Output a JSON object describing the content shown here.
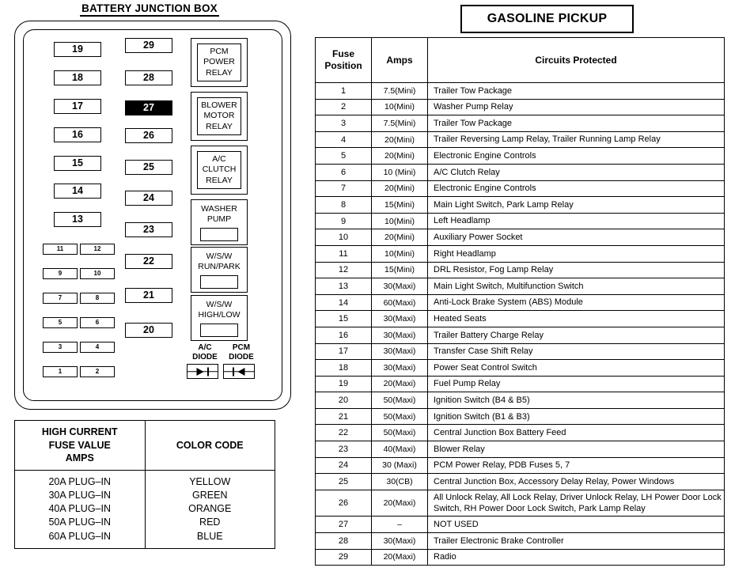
{
  "diagram": {
    "title": "BATTERY JUNCTION BOX",
    "big_fuses_left": [
      "19",
      "18",
      "17",
      "16",
      "15",
      "14",
      "13"
    ],
    "big_fuses_right": [
      "29",
      "28",
      "27",
      "26",
      "25",
      "24",
      "23",
      "22",
      "21",
      "20"
    ],
    "active_fuse": "27",
    "small_fuses": [
      [
        "11",
        "12"
      ],
      [
        "9",
        "10"
      ],
      [
        "7",
        "8"
      ],
      [
        "5",
        "6"
      ],
      [
        "3",
        "4"
      ],
      [
        "1",
        "2"
      ]
    ],
    "relays": [
      {
        "lines": [
          "PCM",
          "POWER",
          "RELAY"
        ],
        "style": "boxed"
      },
      {
        "lines": [
          "BLOWER",
          "MOTOR",
          "RELAY"
        ],
        "style": "boxed"
      },
      {
        "lines": [
          "A/C",
          "CLUTCH",
          "RELAY"
        ],
        "style": "boxed"
      },
      {
        "lines": [
          "WASHER",
          "PUMP"
        ],
        "style": "slot"
      },
      {
        "lines": [
          "W/S/W",
          "RUN/PARK"
        ],
        "style": "slot"
      },
      {
        "lines": [
          "W/S/W",
          "HIGH/LOW"
        ],
        "style": "slot"
      }
    ],
    "diodes": [
      {
        "line1": "A/C",
        "line2": "DIODE",
        "direction": "right"
      },
      {
        "line1": "PCM",
        "line2": "DIODE",
        "direction": "left"
      }
    ]
  },
  "legend": {
    "header_left": "HIGH CURRENT FUSE VALUE AMPS",
    "header_left_lines": [
      "HIGH CURRENT",
      "FUSE VALUE",
      "AMPS"
    ],
    "header_right": "COLOR CODE",
    "values": [
      "20A PLUG–IN",
      "30A PLUG–IN",
      "40A PLUG–IN",
      "50A PLUG–IN",
      "60A PLUG–IN"
    ],
    "colors": [
      "YELLOW",
      "GREEN",
      "ORANGE",
      "RED",
      "BLUE"
    ]
  },
  "table": {
    "title": "GASOLINE PICKUP",
    "headers": {
      "position_line1": "Fuse",
      "position_line2": "Position",
      "amps": "Amps",
      "circuits": "Circuits Protected"
    },
    "rows": [
      {
        "position": "1",
        "amps": "7.5(Mini)",
        "circuits": "Trailer Tow Package"
      },
      {
        "position": "2",
        "amps": "10(Mini)",
        "circuits": "Washer Pump Relay"
      },
      {
        "position": "3",
        "amps": "7.5(Mini)",
        "circuits": "Trailer Tow Package"
      },
      {
        "position": "4",
        "amps": "20(Mini)",
        "circuits": "Trailer Reversing Lamp Relay, Trailer Running Lamp Relay"
      },
      {
        "position": "5",
        "amps": "20(Mini)",
        "circuits": "Electronic Engine Controls"
      },
      {
        "position": "6",
        "amps": "10 (Mini)",
        "circuits": "A/C Clutch Relay"
      },
      {
        "position": "7",
        "amps": "20(Mini)",
        "circuits": "Electronic Engine Controls"
      },
      {
        "position": "8",
        "amps": "15(Mini)",
        "circuits": "Main Light Switch, Park Lamp Relay"
      },
      {
        "position": "9",
        "amps": "10(Mini)",
        "circuits": "Left Headlamp"
      },
      {
        "position": "10",
        "amps": "20(Mini)",
        "circuits": "Auxiliary Power Socket"
      },
      {
        "position": "11",
        "amps": "10(Mini)",
        "circuits": "Right Headlamp"
      },
      {
        "position": "12",
        "amps": "15(Mini)",
        "circuits": "DRL Resistor, Fog Lamp Relay"
      },
      {
        "position": "13",
        "amps": "30(Maxi)",
        "circuits": "Main Light Switch, Multifunction Switch"
      },
      {
        "position": "14",
        "amps": "60(Maxi)",
        "circuits": "Anti-Lock Brake System (ABS) Module"
      },
      {
        "position": "15",
        "amps": "30(Maxi)",
        "circuits": "Heated Seats"
      },
      {
        "position": "16",
        "amps": "30(Maxi)",
        "circuits": "Trailer Battery Charge Relay"
      },
      {
        "position": "17",
        "amps": "30(Maxi)",
        "circuits": "Transfer Case Shift Relay"
      },
      {
        "position": "18",
        "amps": "30(Maxi)",
        "circuits": "Power Seat Control Switch"
      },
      {
        "position": "19",
        "amps": "20(Maxi)",
        "circuits": "Fuel Pump Relay"
      },
      {
        "position": "20",
        "amps": "50(Maxi)",
        "circuits": "Ignition Switch (B4 & B5)"
      },
      {
        "position": "21",
        "amps": "50(Maxi)",
        "circuits": "Ignition Switch (B1 & B3)"
      },
      {
        "position": "22",
        "amps": "50(Maxi)",
        "circuits": "Central Junction Box Battery Feed"
      },
      {
        "position": "23",
        "amps": "40(Maxi)",
        "circuits": "Blower Relay"
      },
      {
        "position": "24",
        "amps": "30 (Maxi)",
        "circuits": "PCM Power Relay, PDB Fuses 5, 7"
      },
      {
        "position": "25",
        "amps": "30(CB)",
        "circuits": "Central Junction Box, Accessory Delay Relay, Power Windows"
      },
      {
        "position": "26",
        "amps": "20(Maxi)",
        "circuits": "All Unlock Relay, All Lock Relay, Driver Unlock Relay, LH Power Door Lock Switch, RH Power Door Lock Switch, Park Lamp Relay"
      },
      {
        "position": "27",
        "amps": "–",
        "circuits": "NOT USED"
      },
      {
        "position": "28",
        "amps": "30(Maxi)",
        "circuits": "Trailer Electronic Brake Controller"
      },
      {
        "position": "29",
        "amps": "20(Maxi)",
        "circuits": "Radio"
      }
    ]
  }
}
